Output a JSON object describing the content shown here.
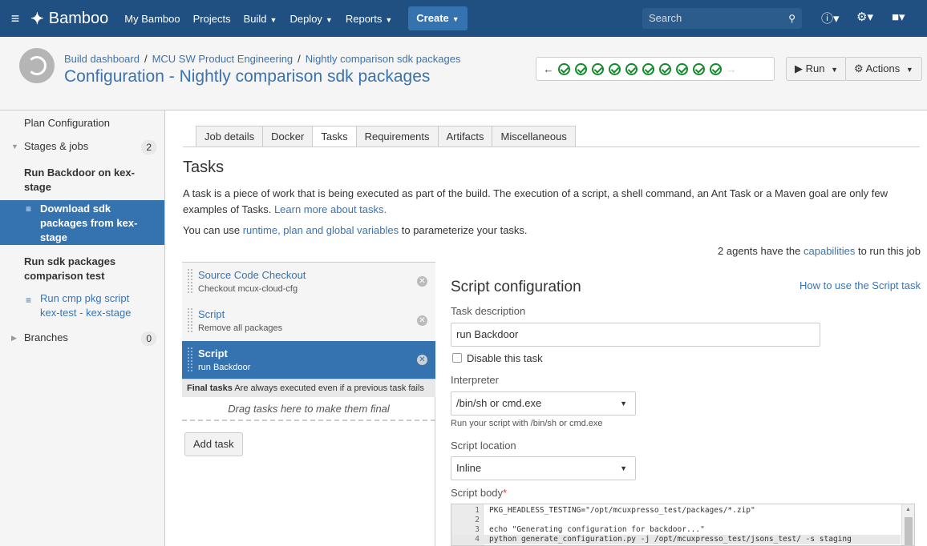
{
  "topnav": {
    "logo": "Bamboo",
    "links": [
      "My Bamboo",
      "Projects",
      "Build",
      "Deploy",
      "Reports"
    ],
    "create": "Create",
    "search_placeholder": "Search"
  },
  "header": {
    "breadcrumb": [
      "Build dashboard",
      "MCU SW Product Engineering",
      "Nightly comparison sdk packages"
    ],
    "title": "Configuration - Nightly comparison sdk packages",
    "result_count": 10,
    "run_label": "Run",
    "actions_label": "Actions"
  },
  "sidebar": {
    "plan_config": "Plan Configuration",
    "stages_jobs": "Stages & jobs",
    "stages_count": "2",
    "stage1": "Run Backdoor on kex-stage",
    "job1": "Download sdk packages from kex-stage",
    "stage2": "Run sdk packages comparison test",
    "job2": "Run cmp pkg script kex-test - kex-stage",
    "branches": "Branches",
    "branches_count": "0"
  },
  "tabs": [
    "Job details",
    "Docker",
    "Tasks",
    "Requirements",
    "Artifacts",
    "Miscellaneous"
  ],
  "main": {
    "heading": "Tasks",
    "intro": "A task is a piece of work that is being executed as part of the build. The execution of a script, a shell command, an Ant Task or a Maven goal are only few examples of Tasks.",
    "learn_more": "Learn more about tasks.",
    "vars_pre": "You can use",
    "vars_link": "runtime, plan and global variables",
    "vars_post": "to parameterize your tasks.",
    "agents_pre": "2 agents have the",
    "agents_link": "capabilities",
    "agents_post": "to run this job"
  },
  "tasks": [
    {
      "name": "Source Code Checkout",
      "desc": "Checkout mcux-cloud-cfg"
    },
    {
      "name": "Script",
      "desc": "Remove all packages"
    },
    {
      "name": "Script",
      "desc": "run Backdoor"
    }
  ],
  "final": {
    "label": "Final tasks",
    "note": "Are always executed even if a previous task fails",
    "drop": "Drag tasks here to make them final",
    "add_task": "Add task"
  },
  "config": {
    "title": "Script configuration",
    "help_link": "How to use the Script task",
    "task_desc_label": "Task description",
    "task_desc_value": "run Backdoor",
    "disable_label": "Disable this task",
    "interpreter_label": "Interpreter",
    "interpreter_value": "/bin/sh or cmd.exe",
    "interpreter_hint": "Run your script with /bin/sh or cmd.exe",
    "location_label": "Script location",
    "location_value": "Inline",
    "body_label": "Script body",
    "body_lines": [
      "PKG_HEADLESS_TESTING=\"/opt/mcuxpresso_test/packages/*.zip\"",
      "",
      "echo \"Generating configuration for backdoor...\"",
      "python generate_configuration.py -j /opt/mcuxpresso_test/jsons_test/ -s staging"
    ]
  }
}
